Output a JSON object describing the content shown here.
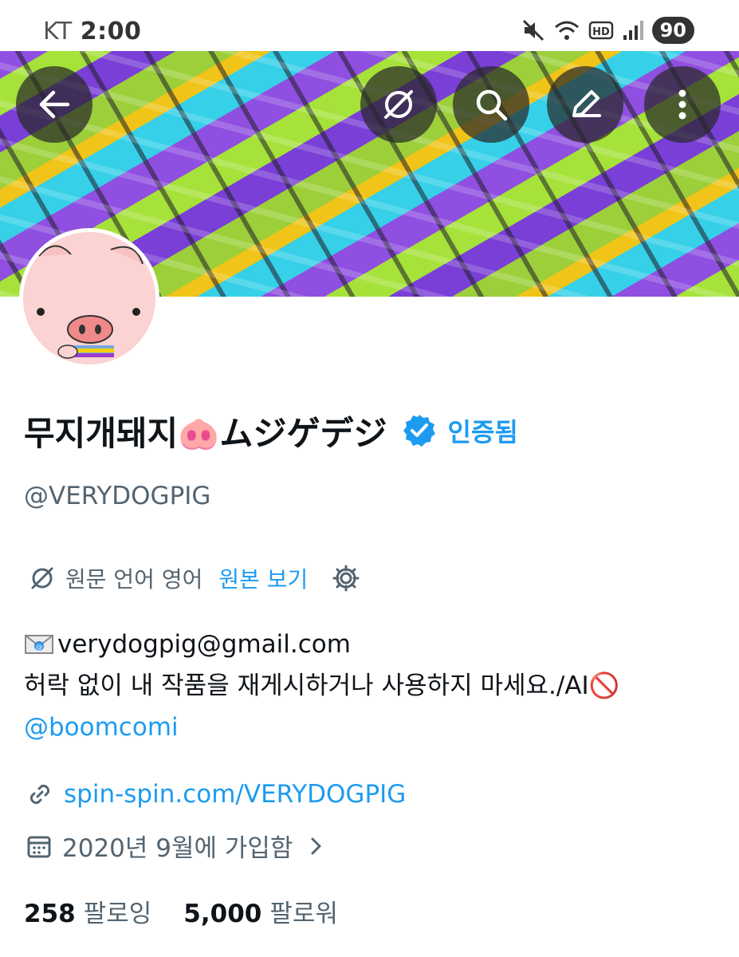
{
  "status_bar": {
    "carrier": "KT",
    "time": "2:00",
    "battery": "90"
  },
  "profile": {
    "display_name": "무지개돼지🐽ムジゲデジ",
    "verified_label": "인증됨",
    "handle": "@VERYDOGPIG",
    "translation": {
      "source_text": "원문 언어 영어",
      "view_original": "원본 보기"
    },
    "bio_line1": "verydogpig@gmail.com",
    "bio_line2": "허락 없이 내 작품을 재게시하거나 사용하지 마세요./AI🚫",
    "bio_mention": "@boomcomi",
    "website": "spin-spin.com/VERYDOGPIG",
    "joined": "2020년 9월에 가입함",
    "following_count": "258",
    "following_label": "팔로잉",
    "followers_count": "5,000",
    "followers_label": "팔로워"
  },
  "icons": {
    "back": "back-arrow-icon",
    "translate": "translate-icon",
    "search": "search-icon",
    "edit": "edit-icon",
    "more": "more-vertical-icon",
    "verified": "verified-badge-icon",
    "settings": "gear-icon",
    "link": "link-icon",
    "calendar": "calendar-icon"
  },
  "colors": {
    "accent": "#1d9bf0",
    "text": "#0f1419",
    "secondary": "#536471"
  }
}
